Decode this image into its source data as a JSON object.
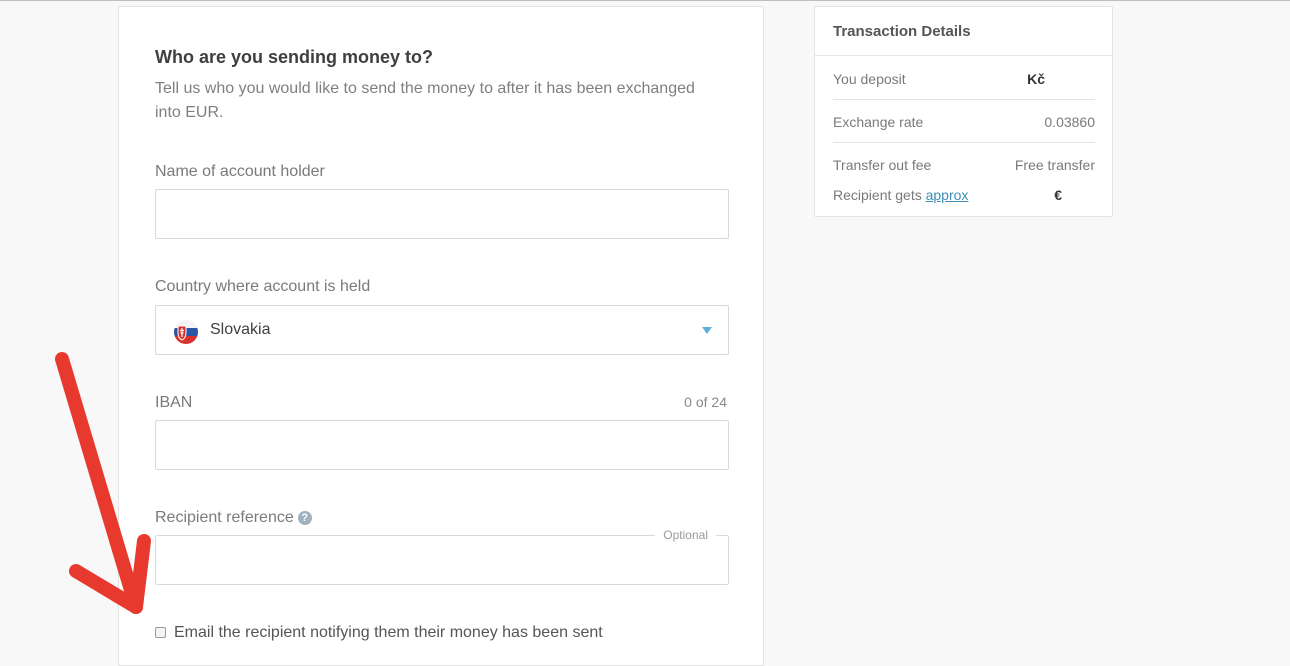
{
  "form": {
    "title": "Who are you sending money to?",
    "subtitle": "Tell us who you would like to send the money to after it has been exchanged into EUR.",
    "name_label": "Name of account holder",
    "name_value": "",
    "country_label": "Country where account is held",
    "country_value": "Slovakia",
    "iban_label": "IBAN",
    "iban_counter": "0 of 24",
    "iban_value": "",
    "reference_label": "Recipient reference",
    "reference_optional": "Optional",
    "reference_value": "",
    "email_checkbox_label": "Email the recipient notifying them their money has been sent",
    "email_checked": false
  },
  "details": {
    "title": "Transaction Details",
    "rows": [
      {
        "label": "You deposit",
        "value": "Kč"
      },
      {
        "label": "Exchange rate",
        "value": "0.03860"
      },
      {
        "label": "Transfer out fee",
        "value": "Free transfer"
      },
      {
        "label_prefix": "Recipient gets ",
        "link": "approx",
        "value": "€"
      }
    ]
  },
  "colors": {
    "accent": "#5fb0d6",
    "link": "#3d8fb8",
    "annotation_arrow": "#e8392f"
  },
  "icons": {
    "country_flag": "slovakia-flag-icon",
    "dropdown": "chevron-down-icon",
    "help": "question-icon"
  }
}
